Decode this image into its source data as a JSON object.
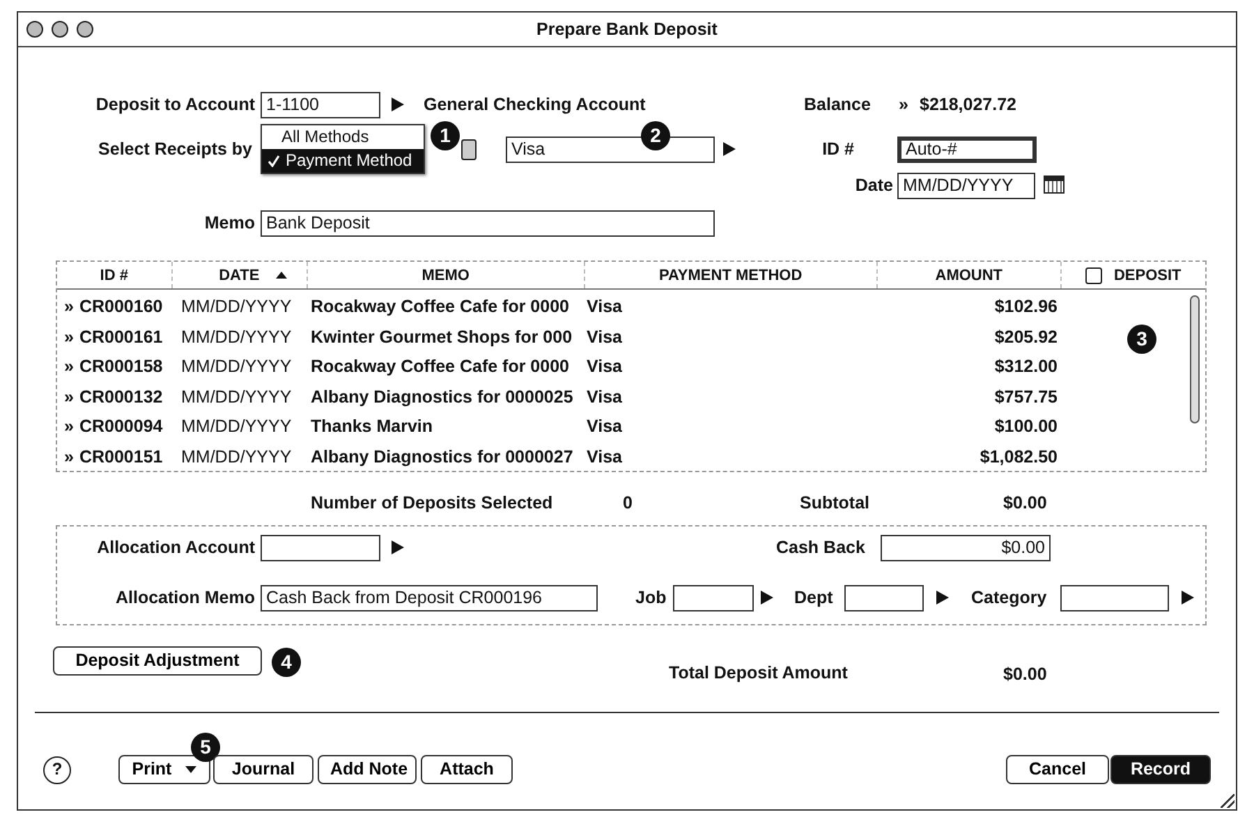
{
  "window": {
    "title": "Prepare Bank Deposit"
  },
  "deposit_to_account": {
    "label": "Deposit to Account",
    "value": "1-1100",
    "account_name": "General Checking Account"
  },
  "balance": {
    "label": "Balance",
    "marker": "»",
    "value": "$218,027.72"
  },
  "select_receipts": {
    "label": "Select Receipts by",
    "callout": "1",
    "menu": [
      {
        "label": "All Methods",
        "selected": false
      },
      {
        "label": "Payment Method",
        "selected": true
      }
    ],
    "method": "Visa",
    "method_callout": "2"
  },
  "id": {
    "label": "ID #",
    "value": "Auto-#",
    "focused": true
  },
  "date": {
    "label": "Date",
    "value": "MM/DD/YYYY"
  },
  "memo": {
    "label": "Memo",
    "value": "Bank Deposit"
  },
  "table": {
    "callout": "3",
    "columns": [
      {
        "label": "ID #",
        "sorted": false
      },
      {
        "label": "DATE",
        "sorted": true
      },
      {
        "label": "MEMO",
        "sorted": false
      },
      {
        "label": "PAYMENT METHOD",
        "sorted": false
      },
      {
        "label": "AMOUNT",
        "sorted": false
      }
    ],
    "deposit_column": {
      "label": "DEPOSIT",
      "checked": false
    },
    "rows": [
      {
        "marker": "»",
        "id": "CR000160",
        "date": "MM/DD/YYYY",
        "memo": "Rocakway Coffee Cafe for 0000",
        "payment_method": "Visa",
        "amount": "$102.96"
      },
      {
        "marker": "»",
        "id": "CR000161",
        "date": "MM/DD/YYYY",
        "memo": "Kwinter Gourmet Shops for 000",
        "payment_method": "Visa",
        "amount": "$205.92"
      },
      {
        "marker": "»",
        "id": "CR000158",
        "date": "MM/DD/YYYY",
        "memo": "Rocakway Coffee Cafe for 0000",
        "payment_method": "Visa",
        "amount": "$312.00"
      },
      {
        "marker": "»",
        "id": "CR000132",
        "date": "MM/DD/YYYY",
        "memo": "Albany Diagnostics for 0000025",
        "payment_method": "Visa",
        "amount": "$757.75"
      },
      {
        "marker": "»",
        "id": "CR000094",
        "date": "MM/DD/YYYY",
        "memo": "Thanks Marvin",
        "payment_method": "Visa",
        "amount": "$100.00"
      },
      {
        "marker": "»",
        "id": "CR000151",
        "date": "MM/DD/YYYY",
        "memo": "Albany Diagnostics for 0000027",
        "payment_method": "Visa",
        "amount": "$1,082.50"
      }
    ]
  },
  "summary": {
    "count_label": "Number of Deposits Selected",
    "count": "0",
    "subtotal_label": "Subtotal",
    "subtotal": "$0.00"
  },
  "allocation": {
    "account_label": "Allocation Account",
    "cash_back_label": "Cash Back",
    "cash_back": "$0.00",
    "memo_label": "Allocation Memo",
    "memo": "Cash Back from Deposit CR000196",
    "job_label": "Job",
    "dept_label": "Dept",
    "category_label": "Category"
  },
  "deposit_adjustment": {
    "label": "Deposit Adjustment",
    "callout": "4"
  },
  "total": {
    "label": "Total Deposit Amount",
    "value": "$0.00"
  },
  "footer": {
    "help": "?",
    "buttons": [
      {
        "label": "Print",
        "kind": "menu",
        "callout": "5"
      },
      {
        "label": "Journal",
        "kind": "plain"
      },
      {
        "label": "Add Note",
        "kind": "plain"
      },
      {
        "label": "Attach",
        "kind": "plain"
      }
    ],
    "cancel": "Cancel",
    "record": "Record"
  }
}
